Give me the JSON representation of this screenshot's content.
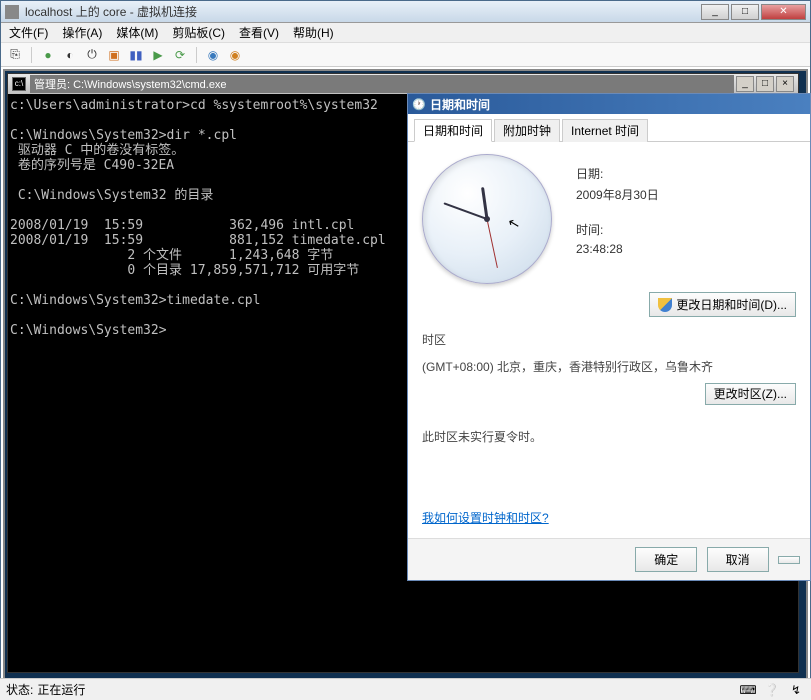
{
  "vm": {
    "title": "localhost 上的 core - 虚拟机连接"
  },
  "titlebar_buttons": {
    "min": "_",
    "max": "□",
    "close": "✕"
  },
  "menu": {
    "file": "文件(F)",
    "action": "操作(A)",
    "media": "媒体(M)",
    "clipboard": "剪贴板(C)",
    "view": "查看(V)",
    "help": "帮助(H)"
  },
  "cmd": {
    "title": "管理员: C:\\Windows\\system32\\cmd.exe",
    "min": "_",
    "max": "□",
    "close": "×",
    "content": "c:\\Users\\administrator>cd %systemroot%\\system32\n\nC:\\Windows\\System32>dir *.cpl\n 驱动器 C 中的卷没有标签。\n 卷的序列号是 C490-32EA\n\n C:\\Windows\\System32 的目录\n\n2008/01/19  15:59           362,496 intl.cpl\n2008/01/19  15:59           881,152 timedate.cpl\n               2 个文件      1,243,648 字节\n               0 个目录 17,859,571,712 可用字节\n\nC:\\Windows\\System32>timedate.cpl\n\nC:\\Windows\\System32>"
  },
  "dt": {
    "window_title": "日期和时间",
    "tabs": {
      "dt": "日期和时间",
      "extra": "附加时钟",
      "internet": "Internet 时间"
    },
    "date_label": "日期:",
    "date_value": "2009年8月30日",
    "time_label": "时间:",
    "time_value": "23:48:28",
    "change_dt": "更改日期和时间(D)...",
    "tz_label": "时区",
    "tz_value": "(GMT+08:00) 北京，重庆，香港特别行政区，乌鲁木齐",
    "change_tz": "更改时区(Z)...",
    "dst_note": "此时区未实行夏令时。",
    "help_link": "我如何设置时钟和时区?",
    "ok": "确定",
    "cancel": "取消"
  },
  "status": {
    "label": "状态:",
    "value": "正在运行"
  }
}
